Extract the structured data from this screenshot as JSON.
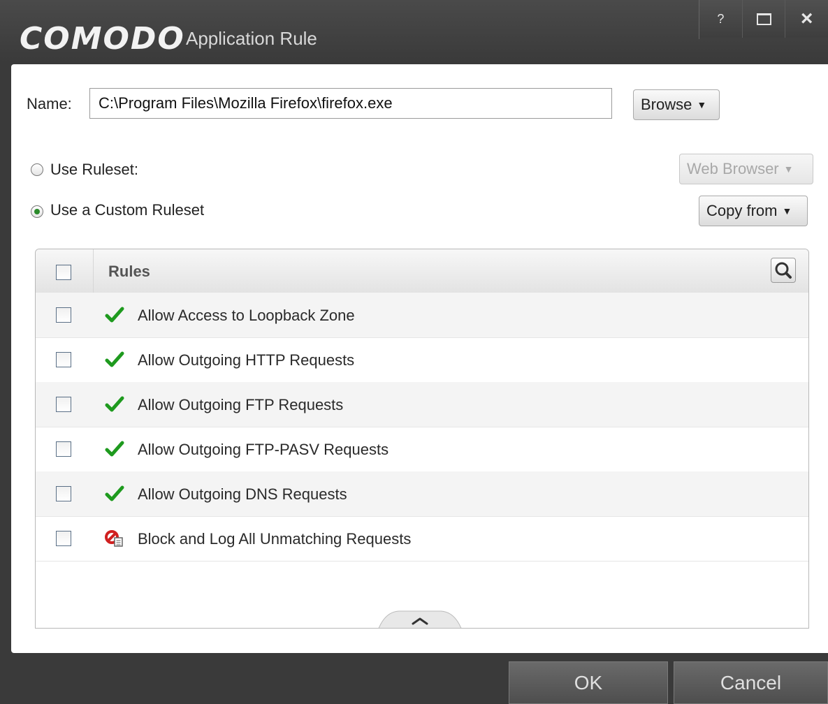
{
  "titlebar": {
    "brand": "COMODO",
    "title": "Application Rule",
    "help_label": "?",
    "close_label": "×"
  },
  "form": {
    "name_label": "Name:",
    "name_value": "C:\\Program Files\\Mozilla Firefox\\firefox.exe",
    "browse_label": "Browse",
    "use_ruleset_label": "Use Ruleset:",
    "use_ruleset_selected": false,
    "ruleset_dropdown_label": "Web Browser",
    "use_custom_label": "Use a Custom Ruleset",
    "use_custom_selected": true,
    "copy_from_label": "Copy from"
  },
  "rules_table": {
    "header": "Rules",
    "rows": [
      {
        "label": "Allow Access to Loopback Zone",
        "action": "allow",
        "checked": false
      },
      {
        "label": "Allow Outgoing HTTP Requests",
        "action": "allow",
        "checked": false
      },
      {
        "label": "Allow Outgoing FTP Requests",
        "action": "allow",
        "checked": false
      },
      {
        "label": "Allow Outgoing FTP-PASV Requests",
        "action": "allow",
        "checked": false
      },
      {
        "label": "Allow Outgoing DNS Requests",
        "action": "allow",
        "checked": false
      },
      {
        "label": "Block and Log All Unmatching Requests",
        "action": "block-log",
        "checked": false
      }
    ]
  },
  "footer": {
    "ok_label": "OK",
    "cancel_label": "Cancel"
  },
  "colors": {
    "allow_check": "#1e9a1e",
    "block_red": "#d02020",
    "titlebar_bg": "#3a3a3a"
  }
}
